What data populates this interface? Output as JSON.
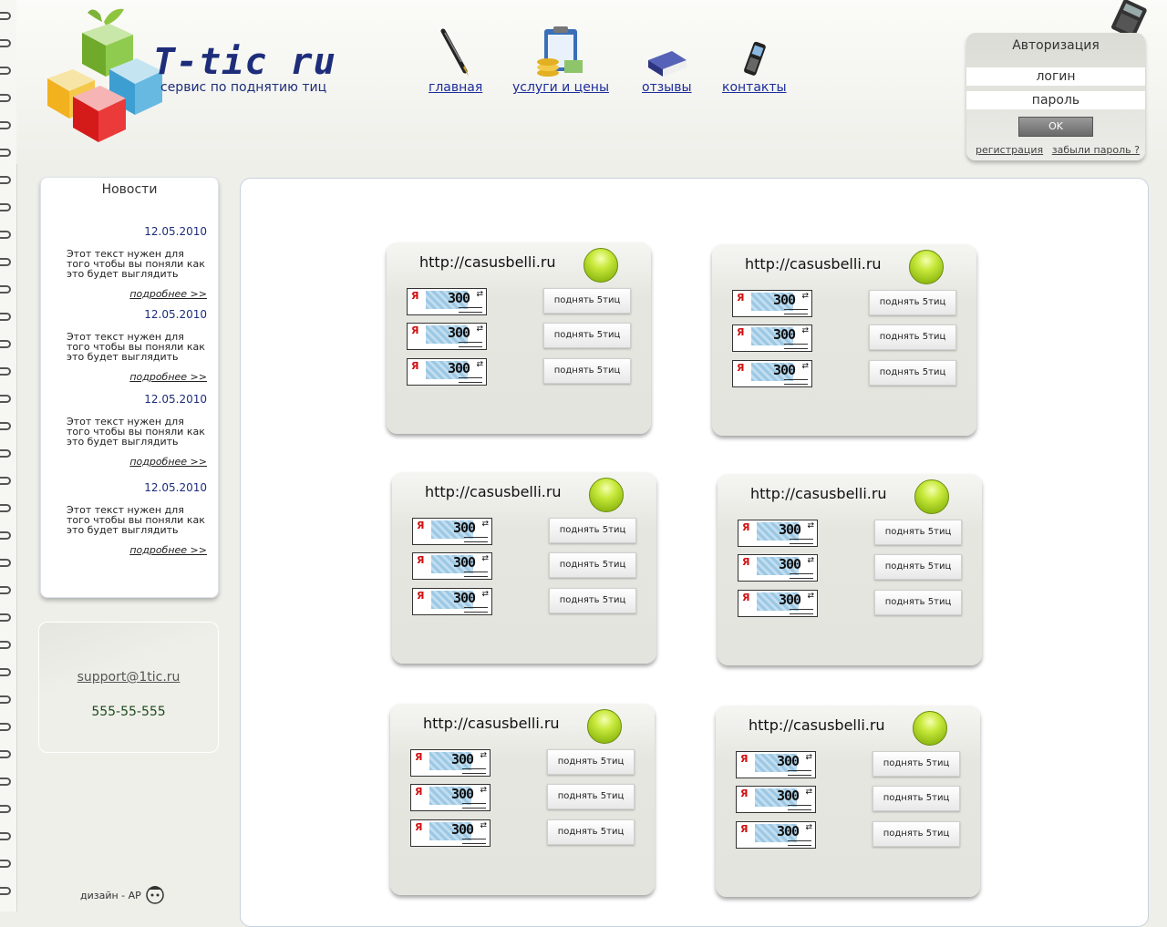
{
  "logo": {
    "title": "T-tic ru",
    "subtitle": "сервис по поднятию тиц"
  },
  "nav": [
    {
      "label": "главная",
      "icon": "pen-icon"
    },
    {
      "label": "услуги и цены",
      "icon": "clipboard-coins-icon"
    },
    {
      "label": "отзывы",
      "icon": "book-icon"
    },
    {
      "label": "контакты",
      "icon": "mobile-phone-icon"
    }
  ],
  "auth": {
    "title": "Авторизация",
    "login_placeholder": "логин",
    "password_placeholder": "пароль",
    "ok_label": "OK",
    "register_link": "регистрация",
    "forgot_link": "забыли пароль ?"
  },
  "news": {
    "title": "Новости",
    "items": [
      {
        "date": "12.05.2010",
        "text": "Этот текст нужен для того чтобы вы поняли как это будет выглядить",
        "more": "подробнее >>"
      },
      {
        "date": "12.05.2010",
        "text": "Этот текст нужен для того чтобы вы поняли как это будет выглядить",
        "more": "подробнее >>"
      },
      {
        "date": "12.05.2010",
        "text": "Этот текст нужен для того чтобы вы поняли как это будет выглядить",
        "more": "подробнее >>"
      },
      {
        "date": "12.05.2010",
        "text": "Этот текст нужен для того чтобы вы поняли как это будет выглядить",
        "more": "подробнее >>"
      }
    ]
  },
  "contacts": {
    "email": "support@1tic.ru",
    "phone": "555-55-555"
  },
  "footer": {
    "design": "дизайн - AP"
  },
  "counter": {
    "ya": "Я",
    "value": "300"
  },
  "cards": [
    {
      "url": "http://casusbelli.ru",
      "buttons": [
        "поднять 5тиц",
        "поднять 5тиц",
        "поднять 5тиц"
      ]
    },
    {
      "url": "http://casusbelli.ru",
      "buttons": [
        "поднять 5тиц",
        "поднять 5тиц",
        "поднять 5тиц"
      ]
    },
    {
      "url": "http://casusbelli.ru",
      "buttons": [
        "поднять 5тиц",
        "поднять 5тиц",
        "поднять 5тиц"
      ]
    },
    {
      "url": "http://casusbelli.ru",
      "buttons": [
        "поднять 5тиц",
        "поднять 5тиц",
        "поднять 5тиц"
      ]
    },
    {
      "url": "http://casusbelli.ru",
      "buttons": [
        "поднять 5тиц",
        "поднять 5тиц",
        "поднять 5тиц"
      ]
    },
    {
      "url": "http://casusbelli.ru",
      "buttons": [
        "поднять 5тиц",
        "поднять 5тиц",
        "поднять 5тиц"
      ]
    }
  ],
  "colors": {
    "nav_link": "#1d2d9a",
    "brand": "#1d2d7a",
    "status_led": "#a8d020"
  }
}
